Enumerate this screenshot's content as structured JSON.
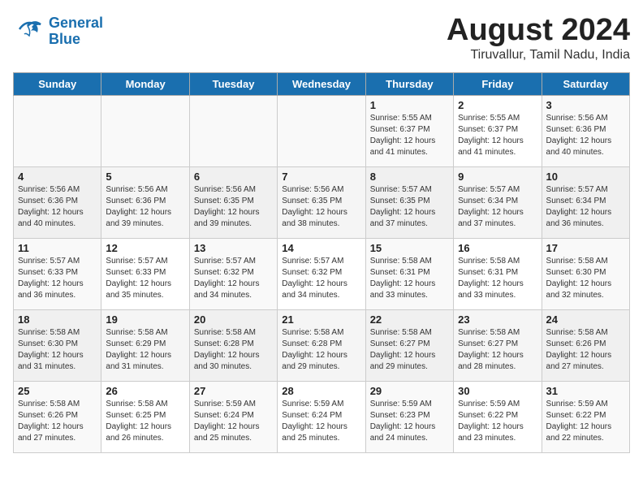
{
  "header": {
    "logo_line1": "General",
    "logo_line2": "Blue",
    "title": "August 2024",
    "subtitle": "Tiruvallur, Tamil Nadu, India"
  },
  "weekdays": [
    "Sunday",
    "Monday",
    "Tuesday",
    "Wednesday",
    "Thursday",
    "Friday",
    "Saturday"
  ],
  "weeks": [
    [
      {
        "day": "",
        "info": ""
      },
      {
        "day": "",
        "info": ""
      },
      {
        "day": "",
        "info": ""
      },
      {
        "day": "",
        "info": ""
      },
      {
        "day": "1",
        "info": "Sunrise: 5:55 AM\nSunset: 6:37 PM\nDaylight: 12 hours\nand 41 minutes."
      },
      {
        "day": "2",
        "info": "Sunrise: 5:55 AM\nSunset: 6:37 PM\nDaylight: 12 hours\nand 41 minutes."
      },
      {
        "day": "3",
        "info": "Sunrise: 5:56 AM\nSunset: 6:36 PM\nDaylight: 12 hours\nand 40 minutes."
      }
    ],
    [
      {
        "day": "4",
        "info": "Sunrise: 5:56 AM\nSunset: 6:36 PM\nDaylight: 12 hours\nand 40 minutes."
      },
      {
        "day": "5",
        "info": "Sunrise: 5:56 AM\nSunset: 6:36 PM\nDaylight: 12 hours\nand 39 minutes."
      },
      {
        "day": "6",
        "info": "Sunrise: 5:56 AM\nSunset: 6:35 PM\nDaylight: 12 hours\nand 39 minutes."
      },
      {
        "day": "7",
        "info": "Sunrise: 5:56 AM\nSunset: 6:35 PM\nDaylight: 12 hours\nand 38 minutes."
      },
      {
        "day": "8",
        "info": "Sunrise: 5:57 AM\nSunset: 6:35 PM\nDaylight: 12 hours\nand 37 minutes."
      },
      {
        "day": "9",
        "info": "Sunrise: 5:57 AM\nSunset: 6:34 PM\nDaylight: 12 hours\nand 37 minutes."
      },
      {
        "day": "10",
        "info": "Sunrise: 5:57 AM\nSunset: 6:34 PM\nDaylight: 12 hours\nand 36 minutes."
      }
    ],
    [
      {
        "day": "11",
        "info": "Sunrise: 5:57 AM\nSunset: 6:33 PM\nDaylight: 12 hours\nand 36 minutes."
      },
      {
        "day": "12",
        "info": "Sunrise: 5:57 AM\nSunset: 6:33 PM\nDaylight: 12 hours\nand 35 minutes."
      },
      {
        "day": "13",
        "info": "Sunrise: 5:57 AM\nSunset: 6:32 PM\nDaylight: 12 hours\nand 34 minutes."
      },
      {
        "day": "14",
        "info": "Sunrise: 5:57 AM\nSunset: 6:32 PM\nDaylight: 12 hours\nand 34 minutes."
      },
      {
        "day": "15",
        "info": "Sunrise: 5:58 AM\nSunset: 6:31 PM\nDaylight: 12 hours\nand 33 minutes."
      },
      {
        "day": "16",
        "info": "Sunrise: 5:58 AM\nSunset: 6:31 PM\nDaylight: 12 hours\nand 33 minutes."
      },
      {
        "day": "17",
        "info": "Sunrise: 5:58 AM\nSunset: 6:30 PM\nDaylight: 12 hours\nand 32 minutes."
      }
    ],
    [
      {
        "day": "18",
        "info": "Sunrise: 5:58 AM\nSunset: 6:30 PM\nDaylight: 12 hours\nand 31 minutes."
      },
      {
        "day": "19",
        "info": "Sunrise: 5:58 AM\nSunset: 6:29 PM\nDaylight: 12 hours\nand 31 minutes."
      },
      {
        "day": "20",
        "info": "Sunrise: 5:58 AM\nSunset: 6:28 PM\nDaylight: 12 hours\nand 30 minutes."
      },
      {
        "day": "21",
        "info": "Sunrise: 5:58 AM\nSunset: 6:28 PM\nDaylight: 12 hours\nand 29 minutes."
      },
      {
        "day": "22",
        "info": "Sunrise: 5:58 AM\nSunset: 6:27 PM\nDaylight: 12 hours\nand 29 minutes."
      },
      {
        "day": "23",
        "info": "Sunrise: 5:58 AM\nSunset: 6:27 PM\nDaylight: 12 hours\nand 28 minutes."
      },
      {
        "day": "24",
        "info": "Sunrise: 5:58 AM\nSunset: 6:26 PM\nDaylight: 12 hours\nand 27 minutes."
      }
    ],
    [
      {
        "day": "25",
        "info": "Sunrise: 5:58 AM\nSunset: 6:26 PM\nDaylight: 12 hours\nand 27 minutes."
      },
      {
        "day": "26",
        "info": "Sunrise: 5:58 AM\nSunset: 6:25 PM\nDaylight: 12 hours\nand 26 minutes."
      },
      {
        "day": "27",
        "info": "Sunrise: 5:59 AM\nSunset: 6:24 PM\nDaylight: 12 hours\nand 25 minutes."
      },
      {
        "day": "28",
        "info": "Sunrise: 5:59 AM\nSunset: 6:24 PM\nDaylight: 12 hours\nand 25 minutes."
      },
      {
        "day": "29",
        "info": "Sunrise: 5:59 AM\nSunset: 6:23 PM\nDaylight: 12 hours\nand 24 minutes."
      },
      {
        "day": "30",
        "info": "Sunrise: 5:59 AM\nSunset: 6:22 PM\nDaylight: 12 hours\nand 23 minutes."
      },
      {
        "day": "31",
        "info": "Sunrise: 5:59 AM\nSunset: 6:22 PM\nDaylight: 12 hours\nand 22 minutes."
      }
    ]
  ]
}
